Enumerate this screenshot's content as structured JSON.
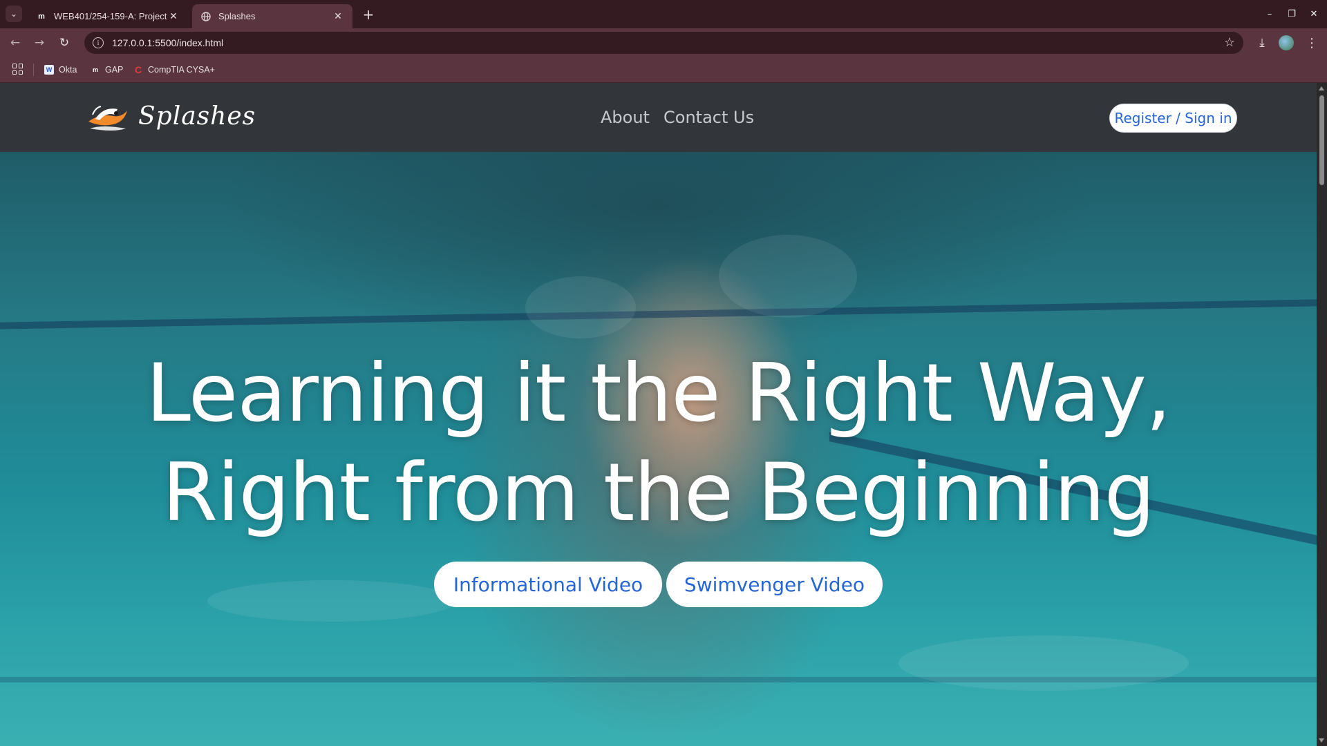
{
  "browser": {
    "tabs": [
      {
        "favicon": "moodle-m-icon",
        "title": "WEB401/254-159-A: Project",
        "active": false
      },
      {
        "favicon": "globe-icon",
        "title": "Splashes",
        "active": true
      }
    ],
    "url": "127.0.0.1:5500/index.html",
    "bookmarks": [
      {
        "label": "Okta",
        "icon": "okta-w-icon"
      },
      {
        "label": "GAP",
        "icon": "moodle-m-icon"
      },
      {
        "label": "CompTIA CYSA+",
        "icon": "comptia-c-icon"
      }
    ]
  },
  "site": {
    "brand": "Splashes",
    "nav": {
      "about": "About",
      "contact": "Contact Us"
    },
    "signin": "Register / Sign in",
    "hero": {
      "line1": "Learning it the Right Way,",
      "line2": "Right from the Beginning",
      "btn_info": "Informational Video",
      "btn_swim": "Swimvenger Video"
    }
  },
  "colors": {
    "accent_link": "#2466d8",
    "nav_bg": "#32353a",
    "chrome_bg": "#5a3540",
    "water": "#2aa0a8"
  }
}
